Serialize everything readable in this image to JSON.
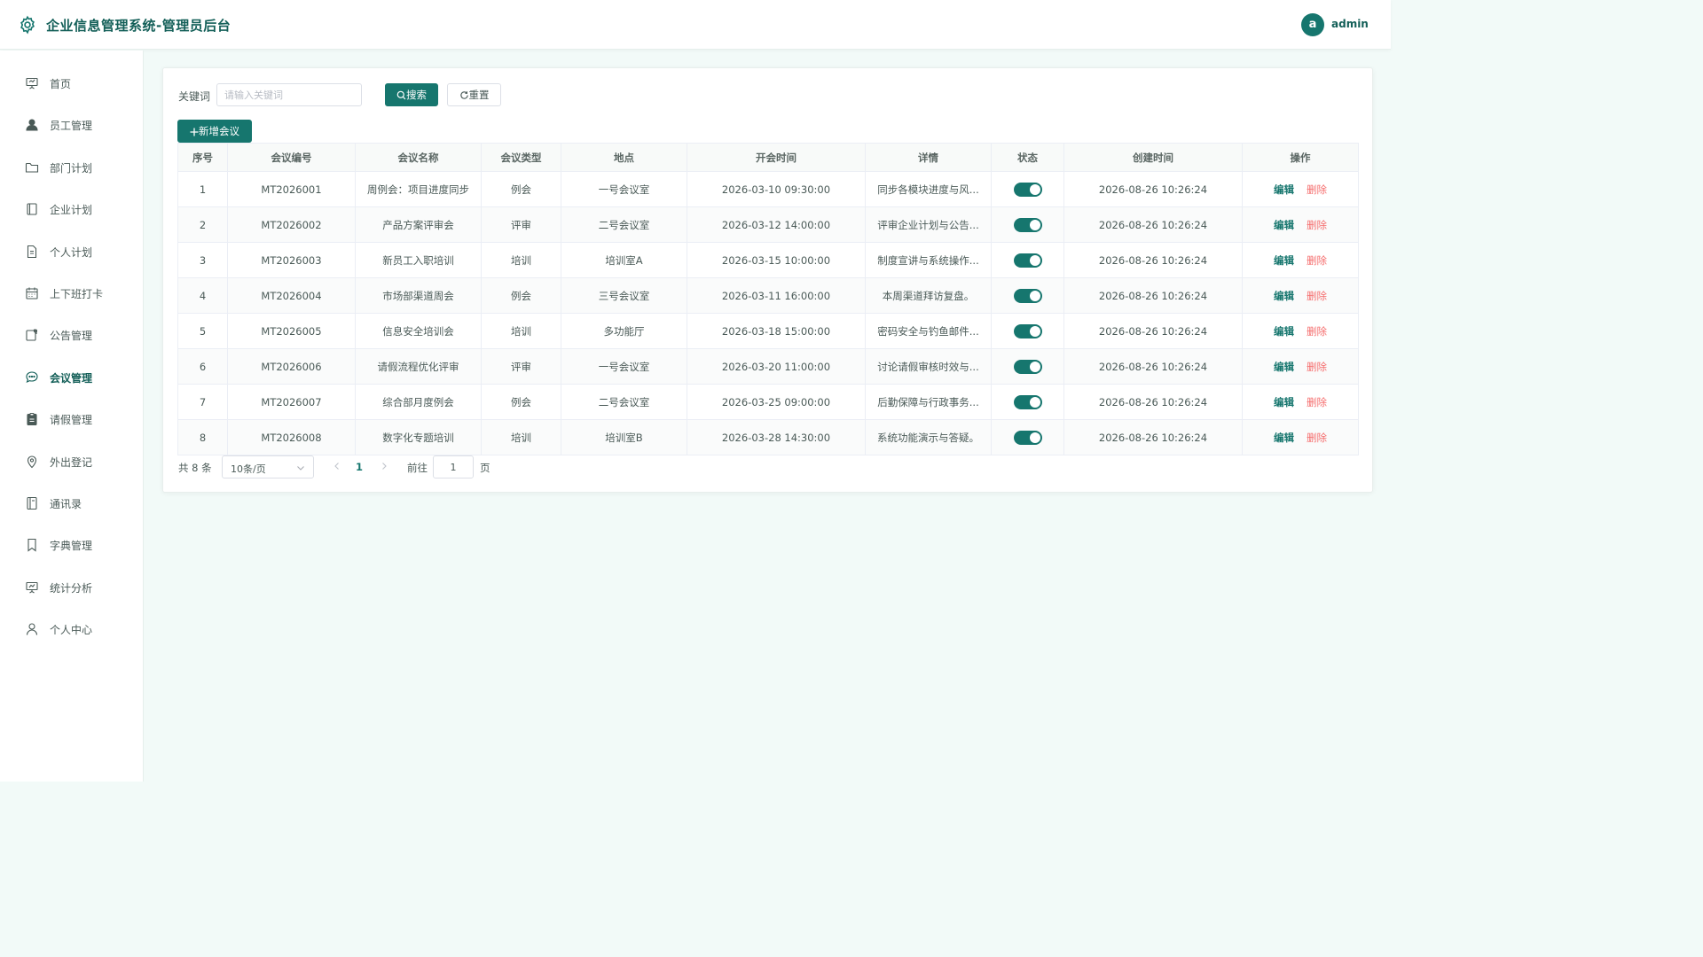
{
  "app": {
    "title": "企业信息管理系统-管理员后台",
    "user": {
      "avatar_letter": "a",
      "name": "admin"
    }
  },
  "colors": {
    "primary": "#16766e",
    "brand_text": "#135f58",
    "danger": "#f56c6c",
    "background": "#f2faf8"
  },
  "sidebar": {
    "items": [
      {
        "label": "首页",
        "icon": "presentation-board-icon",
        "active": false
      },
      {
        "label": "员工管理",
        "icon": "user-filled-icon",
        "active": false
      },
      {
        "label": "部门计划",
        "icon": "folder-icon",
        "active": false
      },
      {
        "label": "企业计划",
        "icon": "notebook-icon",
        "active": false
      },
      {
        "label": "个人计划",
        "icon": "document-icon",
        "active": false
      },
      {
        "label": "上下班打卡",
        "icon": "calendar-icon",
        "active": false
      },
      {
        "label": "公告管理",
        "icon": "notice-icon",
        "active": false
      },
      {
        "label": "会议管理",
        "icon": "chat-bubble-icon",
        "active": true
      },
      {
        "label": "请假管理",
        "icon": "clipboard-icon",
        "active": false
      },
      {
        "label": "外出登记",
        "icon": "location-pin-icon",
        "active": false
      },
      {
        "label": "通讯录",
        "icon": "contact-book-icon",
        "active": false
      },
      {
        "label": "字典管理",
        "icon": "bookmark-icon",
        "active": false
      },
      {
        "label": "统计分析",
        "icon": "chart-board-icon",
        "active": false
      },
      {
        "label": "个人中心",
        "icon": "user-outline-icon",
        "active": false
      }
    ]
  },
  "search": {
    "keyword_label": "关键词",
    "keyword_placeholder": "请输入关键词",
    "keyword_value": "",
    "search_button": "搜索",
    "reset_button": "重置",
    "add_button": "新增会议"
  },
  "table": {
    "columns": [
      "序号",
      "会议编号",
      "会议名称",
      "会议类型",
      "地点",
      "开会时间",
      "详情",
      "状态",
      "创建时间",
      "操作"
    ],
    "edit_label": "编辑",
    "delete_label": "删除",
    "rows": [
      {
        "index": "1",
        "code": "MT2026001",
        "name": "周例会：项目进度同步",
        "type": "例会",
        "location": "一号会议室",
        "time": "2026-03-10 09:30:00",
        "detail": "同步各模块进度与风...",
        "status": true,
        "created": "2026-08-26 10:26:24"
      },
      {
        "index": "2",
        "code": "MT2026002",
        "name": "产品方案评审会",
        "type": "评审",
        "location": "二号会议室",
        "time": "2026-03-12 14:00:00",
        "detail": "评审企业计划与公告...",
        "status": true,
        "created": "2026-08-26 10:26:24"
      },
      {
        "index": "3",
        "code": "MT2026003",
        "name": "新员工入职培训",
        "type": "培训",
        "location": "培训室A",
        "time": "2026-03-15 10:00:00",
        "detail": "制度宣讲与系统操作...",
        "status": true,
        "created": "2026-08-26 10:26:24"
      },
      {
        "index": "4",
        "code": "MT2026004",
        "name": "市场部渠道周会",
        "type": "例会",
        "location": "三号会议室",
        "time": "2026-03-11 16:00:00",
        "detail": "本周渠道拜访复盘。",
        "status": true,
        "created": "2026-08-26 10:26:24"
      },
      {
        "index": "5",
        "code": "MT2026005",
        "name": "信息安全培训会",
        "type": "培训",
        "location": "多功能厅",
        "time": "2026-03-18 15:00:00",
        "detail": "密码安全与钓鱼邮件...",
        "status": true,
        "created": "2026-08-26 10:26:24"
      },
      {
        "index": "6",
        "code": "MT2026006",
        "name": "请假流程优化评审",
        "type": "评审",
        "location": "一号会议室",
        "time": "2026-03-20 11:00:00",
        "detail": "讨论请假审核时效与...",
        "status": true,
        "created": "2026-08-26 10:26:24"
      },
      {
        "index": "7",
        "code": "MT2026007",
        "name": "综合部月度例会",
        "type": "例会",
        "location": "二号会议室",
        "time": "2026-03-25 09:00:00",
        "detail": "后勤保障与行政事务...",
        "status": true,
        "created": "2026-08-26 10:26:24"
      },
      {
        "index": "8",
        "code": "MT2026008",
        "name": "数字化专题培训",
        "type": "培训",
        "location": "培训室B",
        "time": "2026-03-28 14:30:00",
        "detail": "系统功能演示与答疑。",
        "status": true,
        "created": "2026-08-26 10:26:24"
      }
    ]
  },
  "pagination": {
    "total_text": "共 8 条",
    "page_size": "10条/页",
    "current_page": "1",
    "goto_label": "前往",
    "goto_value": "1",
    "page_suffix": "页"
  }
}
